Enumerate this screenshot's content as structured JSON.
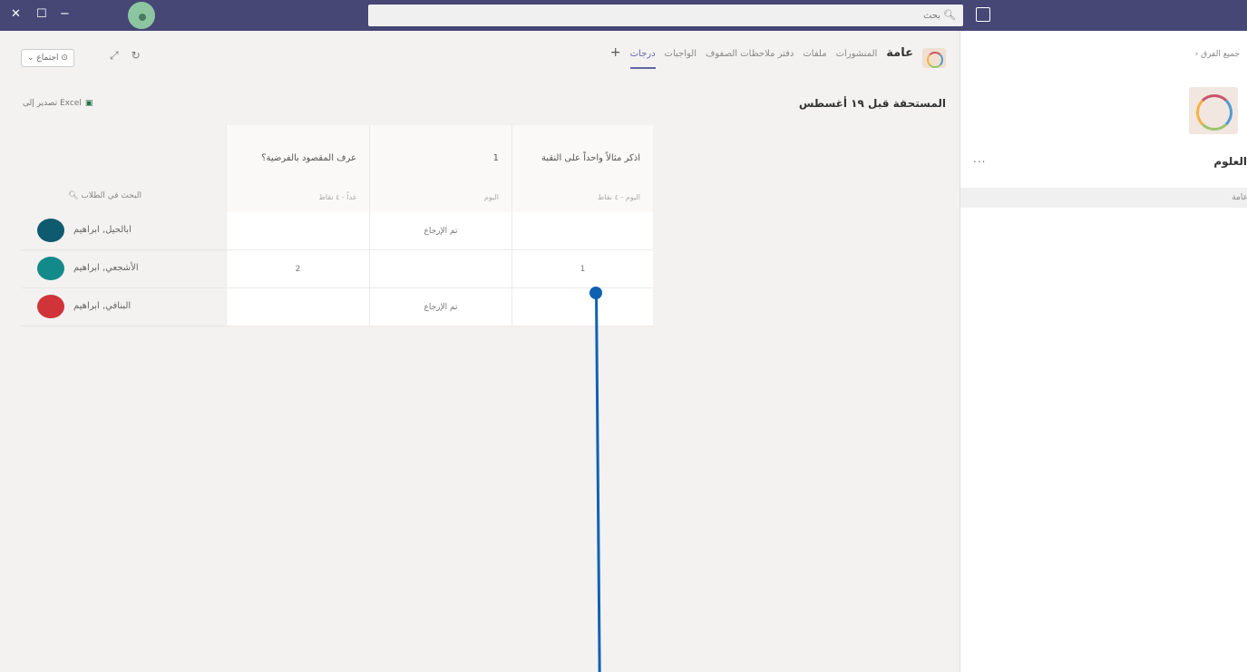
{
  "titlebar": {
    "close_icon": "✕",
    "maximize_icon": "☐",
    "minimize_icon": "−",
    "search_placeholder": "بحث"
  },
  "tabs": {
    "channel": "عامة",
    "items": [
      "المنشورات",
      "ملفات",
      "دفتر ملاحظات الصفوف",
      "الواجبات",
      "درجات"
    ],
    "add": "+"
  },
  "toolbar": {
    "meet_label": "اجتماع",
    "export_label": "تصدير إلى Excel"
  },
  "grades": {
    "due_label": "المستحقة قبل ١٩ أغسطس",
    "student_search_placeholder": "البحث في الطلاب",
    "columns": [
      {
        "title": "اذكر مثالاً واحداً على النقبة",
        "meta": "اليوم - ٤ نقاط"
      },
      {
        "title": "1",
        "meta": "اليوم"
      },
      {
        "title": "عرف المقصود بالفرضية؟",
        "meta": "غداً - ٤ نقاط"
      }
    ],
    "rows": [
      {
        "name": "ابالحيل, ابراهيم",
        "avatar_color": "#0e5a6e",
        "cells": [
          "",
          "تم الإرجاع",
          ""
        ]
      },
      {
        "name": "الأشجعي, ابراهيم",
        "avatar_color": "#138a8a",
        "cells": [
          "1",
          "",
          "2"
        ]
      },
      {
        "name": "البنافي, ابراهيم",
        "avatar_color": "#d13438",
        "cells": [
          "",
          "تم الإرجاع",
          ""
        ]
      }
    ]
  },
  "right_panel": {
    "back_label": "جميع الفرق",
    "team_name": "العلوم",
    "more": "...",
    "channel": "عامة"
  },
  "colors": {
    "titlebar": "#464775",
    "accent": "#6264a7",
    "annotation": "#0f62b2"
  }
}
